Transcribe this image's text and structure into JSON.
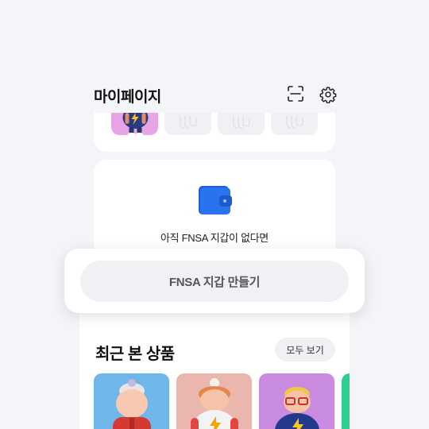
{
  "header": {
    "title": "마이페이지",
    "icons": [
      "scan-icon",
      "gear-icon"
    ]
  },
  "nft_strip": {
    "items": [
      {
        "type": "character",
        "icon": "character-thumb"
      },
      {
        "type": "empty",
        "icon": "placeholder-icon"
      },
      {
        "type": "empty",
        "icon": "placeholder-icon"
      },
      {
        "type": "empty",
        "icon": "placeholder-icon"
      }
    ]
  },
  "wallet": {
    "icon": "wallet-icon",
    "empty_text": "아직 FNSA 지갑이 없다면"
  },
  "cta": {
    "label": "FNSA 지갑 만들기"
  },
  "recent": {
    "title": "최근 본 상품",
    "see_all": "모두 보기",
    "products": [
      {
        "icon": "grandma-character",
        "bg": "#6fb6ea"
      },
      {
        "icon": "bolt-character",
        "bg": "#e9b7ae"
      },
      {
        "icon": "glasses-character",
        "bg": "#c98be0"
      },
      {
        "icon": "product-thumb",
        "bg": "#2ecf8f"
      }
    ]
  },
  "colors": {
    "background": "#f4f5f8",
    "card": "#ffffff",
    "wallet_blue": "#2a73f0"
  }
}
